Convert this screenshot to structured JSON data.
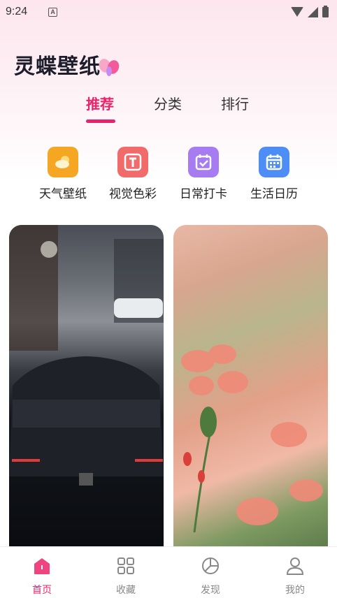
{
  "status_bar": {
    "time": "9:24"
  },
  "app": {
    "title": "灵蝶壁纸"
  },
  "tabs": [
    {
      "label": "推荐",
      "active": true
    },
    {
      "label": "分类",
      "active": false
    },
    {
      "label": "排行",
      "active": false
    }
  ],
  "shortcuts": [
    {
      "label": "天气壁纸",
      "icon": "weather-icon",
      "color": "#f5a623"
    },
    {
      "label": "视觉色彩",
      "icon": "text-t-icon",
      "color": "#f26b6b"
    },
    {
      "label": "日常打卡",
      "icon": "calendar-check-icon",
      "color": "#a77cf0"
    },
    {
      "label": "生活日历",
      "icon": "calendar-icon",
      "color": "#4c8ef5"
    }
  ],
  "wallpapers": [
    {
      "subject": "wallpaper-car"
    },
    {
      "subject": "wallpaper-flower"
    }
  ],
  "bottom_nav": [
    {
      "label": "首页",
      "icon": "home-icon",
      "active": true
    },
    {
      "label": "收藏",
      "icon": "grid-icon",
      "active": false
    },
    {
      "label": "发现",
      "icon": "pie-chart-icon",
      "active": false
    },
    {
      "label": "我的",
      "icon": "user-icon",
      "active": false
    }
  ],
  "colors": {
    "accent": "#e8246a",
    "title": "#1c1c2a"
  }
}
